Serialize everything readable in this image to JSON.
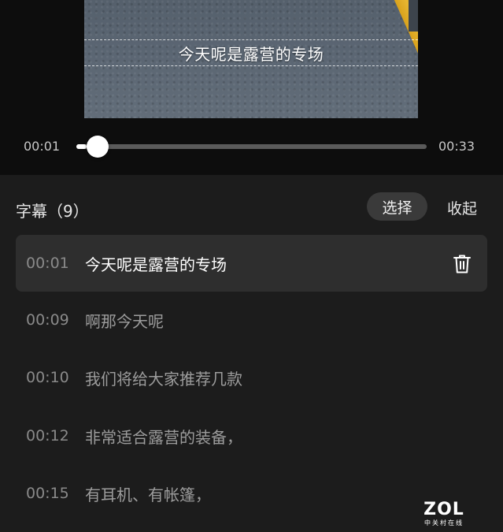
{
  "preview": {
    "subtitle_overlay": "今天呢是露营的专场"
  },
  "player": {
    "current_time": "00:01",
    "total_time": "00:33",
    "progress_fraction": 0.03
  },
  "subtitles_panel": {
    "title": "字幕（9）",
    "select_label": "选择",
    "collapse_label": "收起",
    "items": [
      {
        "time": "00:01",
        "text": "今天呢是露营的专场",
        "active": true
      },
      {
        "time": "00:09",
        "text": "啊那今天呢",
        "active": false
      },
      {
        "time": "00:10",
        "text": "我们将给大家推荐几款",
        "active": false
      },
      {
        "time": "00:12",
        "text": "非常适合露营的装备，",
        "active": false
      },
      {
        "time": "00:15",
        "text": "有耳机、有帐篷，",
        "active": false
      }
    ]
  },
  "watermark": {
    "logo": "ZOL",
    "sub": "中关村在线"
  },
  "colors": {
    "background": "#161616",
    "panel": "#1c1c1c",
    "active_row": "#2e2e2e",
    "lane_line": "#e8b732"
  }
}
